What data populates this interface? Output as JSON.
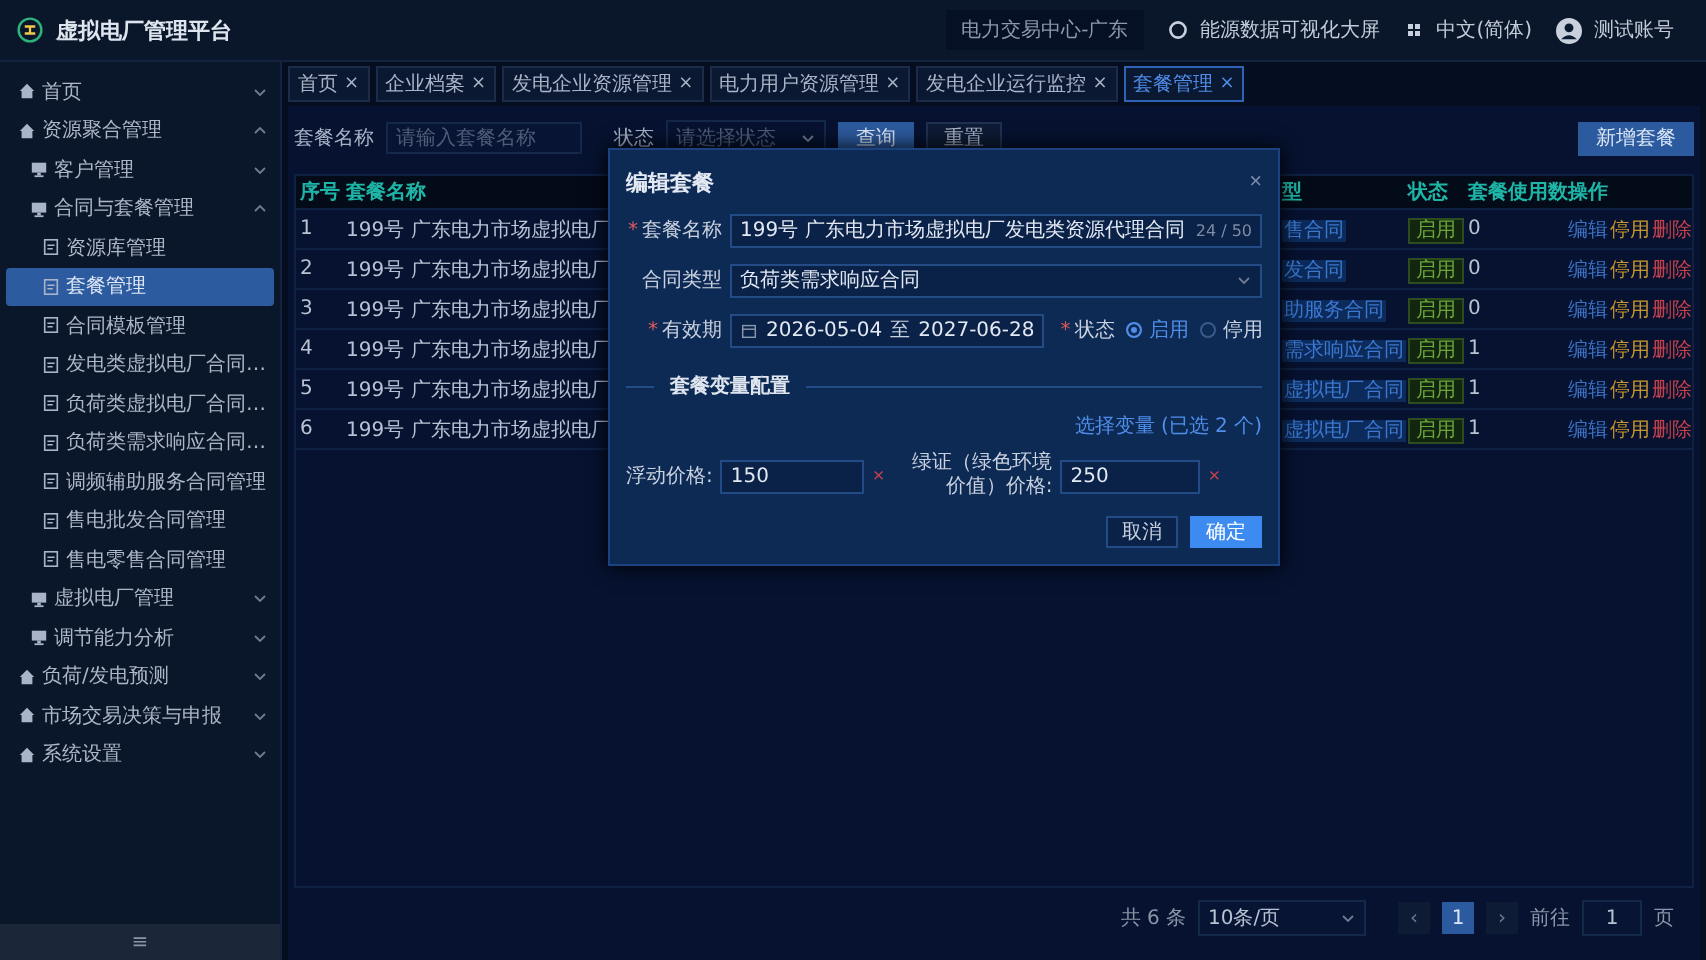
{
  "header": {
    "title": "虚拟电厂管理平台",
    "region": "电力交易中心-广东",
    "dashboard_link": "能源数据可视化大屏",
    "language": "中文(简体)",
    "user": "测试账号"
  },
  "sidebar": {
    "collapse": "≡",
    "items": [
      {
        "label": "首页",
        "selected": false,
        "expanded": false
      },
      {
        "label": "资源聚合管理",
        "selected": false,
        "expanded": true,
        "children": [
          {
            "label": "客户管理",
            "selected": false,
            "expanded": false
          },
          {
            "label": "合同与套餐管理",
            "selected": false,
            "expanded": true,
            "children": [
              {
                "label": "资源库管理",
                "selected": false
              },
              {
                "label": "套餐管理",
                "selected": true
              },
              {
                "label": "合同模板管理",
                "selected": false
              },
              {
                "label": "发电类虚拟电厂合同…",
                "selected": false
              },
              {
                "label": "负荷类虚拟电厂合同…",
                "selected": false
              },
              {
                "label": "负荷类需求响应合同…",
                "selected": false
              },
              {
                "label": "调频辅助服务合同管理",
                "selected": false
              },
              {
                "label": "售电批发合同管理",
                "selected": false
              },
              {
                "label": "售电零售合同管理",
                "selected": false
              }
            ]
          },
          {
            "label": "虚拟电厂管理",
            "selected": false,
            "expanded": false
          },
          {
            "label": "调节能力分析",
            "selected": false,
            "expanded": false
          }
        ]
      },
      {
        "label": "负荷/发电预测",
        "selected": false,
        "expanded": false
      },
      {
        "label": "市场交易决策与申报",
        "selected": false,
        "expanded": false
      },
      {
        "label": "系统设置",
        "selected": false,
        "expanded": false
      }
    ]
  },
  "tabs": [
    {
      "label": "首页",
      "close": "×",
      "selected": false
    },
    {
      "label": "企业档案",
      "close": "×",
      "selected": false
    },
    {
      "label": "发电企业资源管理",
      "close": "×",
      "selected": false
    },
    {
      "label": "电力用户资源管理",
      "close": "×",
      "selected": false
    },
    {
      "label": "发电企业运行监控",
      "close": "×",
      "selected": false
    },
    {
      "label": "套餐管理",
      "close": "×",
      "selected": true
    }
  ],
  "filters": {
    "name_label": "套餐名称",
    "name_placeholder": "请输入套餐名称",
    "status_label": "状态",
    "status_placeholder": "请选择状态",
    "search": "查询",
    "reset": "重置",
    "add": "新增套餐"
  },
  "table": {
    "columns": [
      "序号",
      "套餐名称",
      "型",
      "状态",
      "套餐使用数",
      "操作"
    ],
    "rows": [
      {
        "index": "1",
        "name": "199号 广东电力市场虚拟电厂",
        "type": "售合同",
        "status": "启用",
        "usage": "0",
        "actions": [
          {
            "kind": "edit",
            "label": "编辑"
          },
          {
            "kind": "disable",
            "label": "停用"
          },
          {
            "kind": "delete",
            "label": "删除"
          }
        ]
      },
      {
        "index": "2",
        "name": "199号 广东电力市场虚拟电厂",
        "type": "发合同",
        "status": "启用",
        "usage": "0",
        "actions": [
          {
            "kind": "edit",
            "label": "编辑"
          },
          {
            "kind": "disable",
            "label": "停用"
          },
          {
            "kind": "delete",
            "label": "删除"
          }
        ]
      },
      {
        "index": "3",
        "name": "199号 广东电力市场虚拟电厂",
        "type": "助服务合同",
        "status": "启用",
        "usage": "0",
        "actions": [
          {
            "kind": "edit",
            "label": "编辑"
          },
          {
            "kind": "disable",
            "label": "停用"
          },
          {
            "kind": "delete",
            "label": "删除"
          }
        ]
      },
      {
        "index": "4",
        "name": "199号 广东电力市场虚拟电厂",
        "type": "需求响应合同",
        "status": "启用",
        "usage": "1",
        "actions": [
          {
            "kind": "edit",
            "label": "编辑"
          },
          {
            "kind": "disable",
            "label": "停用"
          },
          {
            "kind": "delete",
            "label": "删除"
          }
        ]
      },
      {
        "index": "5",
        "name": "199号 广东电力市场虚拟电厂",
        "type": "虚拟电厂合同",
        "status": "启用",
        "usage": "1",
        "actions": [
          {
            "kind": "edit",
            "label": "编辑"
          },
          {
            "kind": "disable",
            "label": "停用"
          },
          {
            "kind": "delete",
            "label": "删除"
          }
        ]
      },
      {
        "index": "6",
        "name": "199号 广东电力市场虚拟电厂",
        "type": "虚拟电厂合同",
        "status": "启用",
        "usage": "1",
        "actions": [
          {
            "kind": "edit",
            "label": "编辑"
          },
          {
            "kind": "disable",
            "label": "停用"
          },
          {
            "kind": "delete",
            "label": "删除"
          }
        ]
      }
    ]
  },
  "pagination": {
    "total": "共 6 条",
    "page_size": "10条/页",
    "prev": "‹",
    "pages": [
      {
        "label": "1",
        "selected": true
      }
    ],
    "next": "›",
    "goto_label": "前往",
    "goto_value": "1",
    "goto_suffix": "页"
  },
  "dialog": {
    "title": "编辑套餐",
    "close": "×",
    "required_mark": "*",
    "fields": [
      {
        "kind": "text",
        "label": "套餐名称",
        "required": true,
        "value": "199号 广东电力市场虚拟电厂发电类资源代理合同",
        "counter": "24 / 50"
      },
      {
        "kind": "select",
        "label": "合同类型",
        "required": false,
        "value": "负荷类需求响应合同"
      },
      {
        "kind": "daterange",
        "label": "有效期",
        "required": true,
        "start": "2026-05-04",
        "separator": "至",
        "end": "2027-06-28"
      }
    ],
    "status": {
      "label": "状态",
      "required": true,
      "options": [
        {
          "label": "启用",
          "selected": true
        },
        {
          "label": "停用",
          "selected": false
        }
      ]
    },
    "section": "套餐变量配置",
    "variable_link": "选择变量 (已选 2 个)",
    "prices": [
      {
        "label": "浮动价格:",
        "value": "150",
        "remove": "×"
      },
      {
        "label": "绿证（绿色环境价值）价格:",
        "value": "250",
        "remove": "×"
      }
    ],
    "buttons": [
      {
        "kind": "secondary",
        "label": "取消"
      },
      {
        "kind": "primary",
        "label": "确定"
      }
    ]
  }
}
